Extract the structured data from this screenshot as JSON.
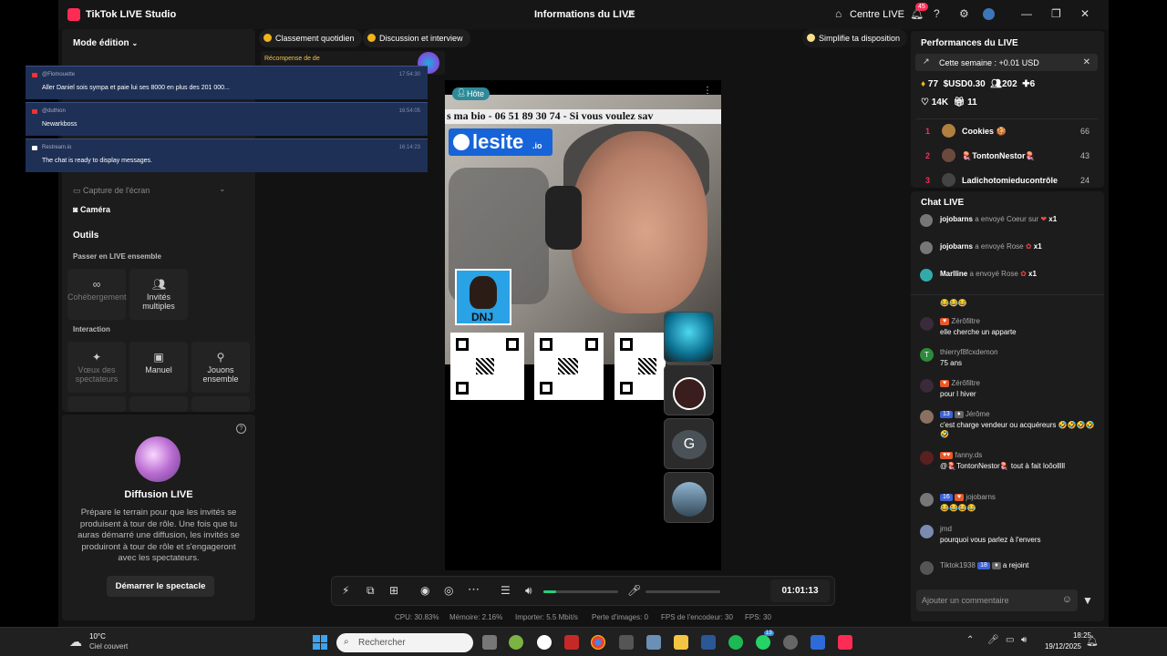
{
  "app": {
    "title": "TikTok LIVE Studio",
    "center_title": "Informations du LIVE",
    "centre_live": "Centre LIVE",
    "notif_count": "45"
  },
  "left": {
    "mode": "Mode édition",
    "capture": "Capture de l'écran",
    "camera": "Caméra",
    "outils": "Outils",
    "passer": "Passer en LIVE ensemble",
    "cohebergement": "Cohébergement",
    "invites": "Invités multiples",
    "interaction": "Interaction",
    "voeux": "Vœux des spectateurs",
    "manuel": "Manuel",
    "jouons": "Jouons ensemble",
    "diffusion_title": "Diffusion LIVE",
    "diffusion_desc": "Prépare le terrain pour que les invités se produisent à tour de rôle. Une fois que tu auras démarré une diffusion, les invités se produiront à tour de rôle et s'engageront avec les spectateurs.",
    "start_btn": "Démarrer le spectacle"
  },
  "overlay": [
    {
      "name": "@Flomouette",
      "time": "17:54:30",
      "msg": "Aller Daniel sois sympa et paie lui ses 8000 en plus des 201 000..."
    },
    {
      "name": "@duthion",
      "time": "16:54:05",
      "msg": "Newarkboss"
    },
    {
      "name": "Restream.io",
      "time": "16:14:23",
      "msg": "The chat is ready to display messages."
    }
  ],
  "chips": {
    "classement": "Classement quotidien",
    "discussion": "Discussion et interview",
    "simplifie": "Simplifie ta disposition",
    "recompense": "Récompense de de"
  },
  "video": {
    "hote": "Hôte",
    "banner": "s ma bio - 06 51 89 30 74 -     Si vous voulez sav",
    "lesite": "lesite",
    "lesite_tld": ".io",
    "dnj": "DNJ",
    "guest_g": "G"
  },
  "controls": {
    "timer": "01:01:13"
  },
  "stats": {
    "cpu": "CPU:  30.83%",
    "mem": "Mémoire:  2.16%",
    "upload": "Importer:  5.5 Mbit/s",
    "loss": "Perte d'images:  0",
    "enc": "FPS de l'encodeur:  30",
    "fps": "FPS:  30"
  },
  "perf": {
    "title": "Performances du LIVE",
    "week": "Cette semaine : +0.01 USD",
    "diamonds": "77",
    "usd": "USD0.30",
    "viewers": "202",
    "new": "6",
    "likes": "14K",
    "gifts": "11",
    "ranking": [
      {
        "rank": "1",
        "user": "Cookies 🍪",
        "score": "66"
      },
      {
        "rank": "2",
        "user": "🪼TontonNestor🪼",
        "score": "43"
      },
      {
        "rank": "3",
        "user": "Ladichotomieducontrôle",
        "score": "24"
      }
    ]
  },
  "chat": {
    "title": "Chat LIVE",
    "gifts": [
      {
        "user": "jojobarns",
        "text": "a envoyé Coeur sur",
        "mult": "x1"
      },
      {
        "user": "jojobarns",
        "text": "a envoyé Rose",
        "mult": "x1"
      },
      {
        "user": "Marlline",
        "text": "a envoyé Rose",
        "mult": "x1"
      }
    ],
    "emojis_top": "😂😂😂",
    "messages": [
      {
        "user": "Zérôfiltre",
        "badge": "",
        "text": "elle cherche un apparte"
      },
      {
        "user": "thierryf8fcxdemon",
        "badge": "",
        "text": "75 ans"
      },
      {
        "user": "Zérôfiltre",
        "badge": "",
        "text": "pour l hiver"
      },
      {
        "user": "Jérôme",
        "badge": "13",
        "text": "c'est charge vendeur ou acquéreurs 🤣🤣🤣🤣🤣"
      },
      {
        "user": "fanny.ds",
        "badge": "",
        "text": "@🪼TontonNestor🪼 tout à fait loôolllll"
      },
      {
        "user": "jojobarns",
        "badge": "16",
        "text": "😂😂😂😂"
      },
      {
        "user": "jmd",
        "badge": "",
        "text": "pourquoi vous parlez à l'envers"
      },
      {
        "user": "Tiktok1938",
        "badge": "18",
        "text": "a rejoint"
      }
    ],
    "input_placeholder": "Ajouter un commentaire"
  },
  "taskbar": {
    "weather_temp": "10°C",
    "weather_desc": "Ciel couvert",
    "search": "Rechercher",
    "time": "18:25",
    "date": "19/12/2025",
    "whatsapp_badge": "13"
  }
}
